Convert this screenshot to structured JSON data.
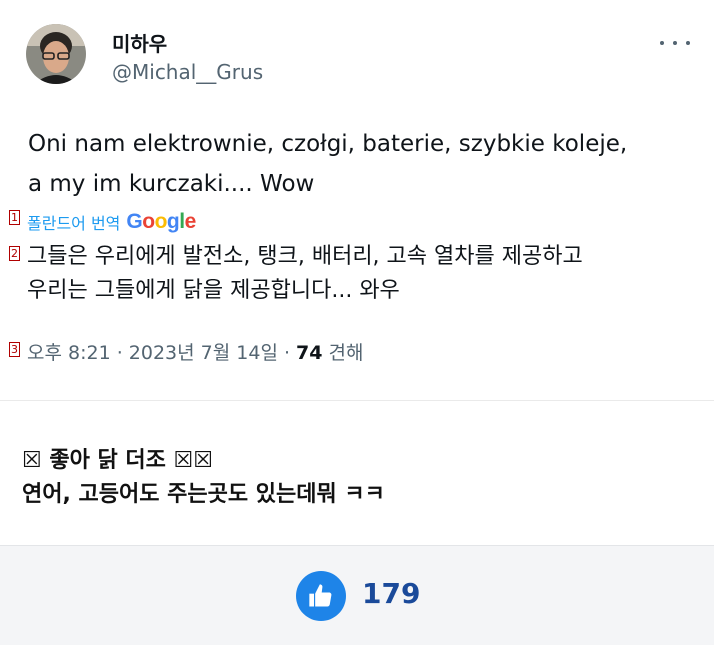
{
  "tweet": {
    "display_name": "미하우",
    "handle": "@Michal__Grus",
    "text_line1": "Oni nam elektrownie, czołgi, baterie, szybkie koleje,",
    "text_line2": "a my im kurczaki.... Wow",
    "translate_label": "폴란드어 번역",
    "google_logo": [
      "G",
      "o",
      "o",
      "g",
      "l",
      "e"
    ],
    "translated_line1": "그들은 우리에게 발전소, 탱크, 배터리, 고속 열차를 제공하고",
    "translated_line2": "우리는 그들에게 닭을 제공합니다... 와우",
    "time": "오후 8:21 · 2023년 7월 14일 · ",
    "views_count": "74",
    "views_label": " 견해",
    "markers": [
      "1",
      "2",
      "3"
    ]
  },
  "comment": {
    "line1": "☒ 좋아 닭 더조 ☒☒",
    "line2": "연어, 고등어도 주는곳도 있는데뭐 ㅋㅋ"
  },
  "footer": {
    "like_count": "179"
  },
  "colors": {
    "link_blue": "#1d9bf0",
    "like_blue": "#1e84e8",
    "google_blue": "#4285f4",
    "google_red": "#ea4335",
    "google_yellow": "#fbbc05",
    "google_green": "#34a853"
  },
  "icons": [
    "avatar",
    "more-dots-icon",
    "thumbs-up-icon"
  ]
}
